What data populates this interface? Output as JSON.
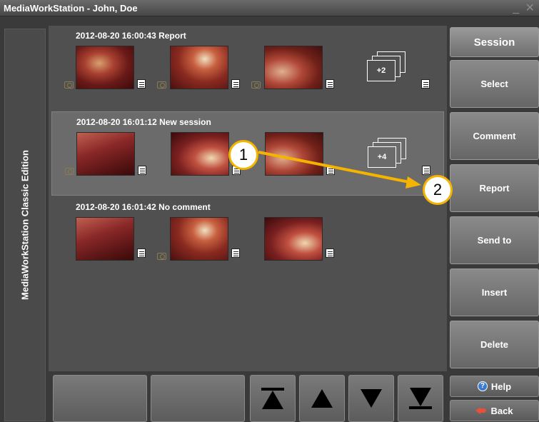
{
  "window": {
    "title": "MediaWorkStation - John, Doe",
    "controls": "_ ✕"
  },
  "sidebar": {
    "label": "MediaWorkStation Classic Edition"
  },
  "sessions": [
    {
      "title": "2012-08-20 16:00:43 Report",
      "more": "+2"
    },
    {
      "title": "2012-08-20 16:01:12 New session",
      "more": "+4"
    },
    {
      "title": "2012-08-20 16:01:42 No comment"
    }
  ],
  "actions": {
    "header": "Session",
    "select": "Select",
    "comment": "Comment",
    "report": "Report",
    "send_to": "Send to",
    "insert": "Insert",
    "delete": "Delete",
    "help": "Help",
    "back": "Back"
  },
  "annotations": {
    "step1": "1",
    "step2": "2",
    "arrow_color": "#f5b400"
  },
  "icons": [
    "camera-icon",
    "note-icon",
    "stack-icon",
    "first-icon",
    "up-icon",
    "down-icon",
    "last-icon",
    "help-icon",
    "back-icon"
  ]
}
